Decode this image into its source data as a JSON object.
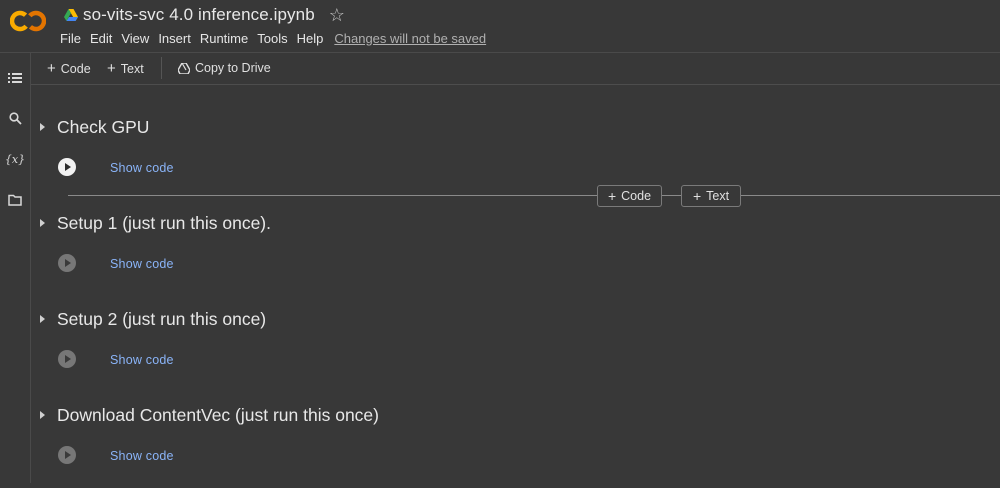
{
  "header": {
    "notebook_title": "so-vits-svc 4.0 inference.ipynb",
    "star_icon": "star-outline-icon",
    "menu": [
      "File",
      "Edit",
      "View",
      "Insert",
      "Runtime",
      "Tools",
      "Help"
    ],
    "save_status": "Changes will not be saved"
  },
  "toolbar": {
    "code_label": "Code",
    "text_label": "Text",
    "copy_drive_label": "Copy to Drive"
  },
  "rail": {
    "icons": [
      "table-of-contents-icon",
      "search-icon",
      "variables-icon",
      "files-icon"
    ],
    "variables_glyph": "{x}"
  },
  "sections": [
    {
      "title": "Check GPU",
      "show_code": "Show code",
      "run_state": "active"
    },
    {
      "title": "Setup 1 (just run this once).",
      "show_code": "Show code",
      "run_state": "idle"
    },
    {
      "title": "Setup 2 (just run this once)",
      "show_code": "Show code",
      "run_state": "idle"
    },
    {
      "title": "Download ContentVec (just run this once)",
      "show_code": "Show code",
      "run_state": "idle"
    }
  ],
  "insert_bar": {
    "code_label": "Code",
    "text_label": "Text"
  },
  "colors": {
    "background": "#383838",
    "link": "#8ab4f8",
    "logo_orange": "#f9ab00",
    "logo_dark_orange": "#e37400"
  }
}
